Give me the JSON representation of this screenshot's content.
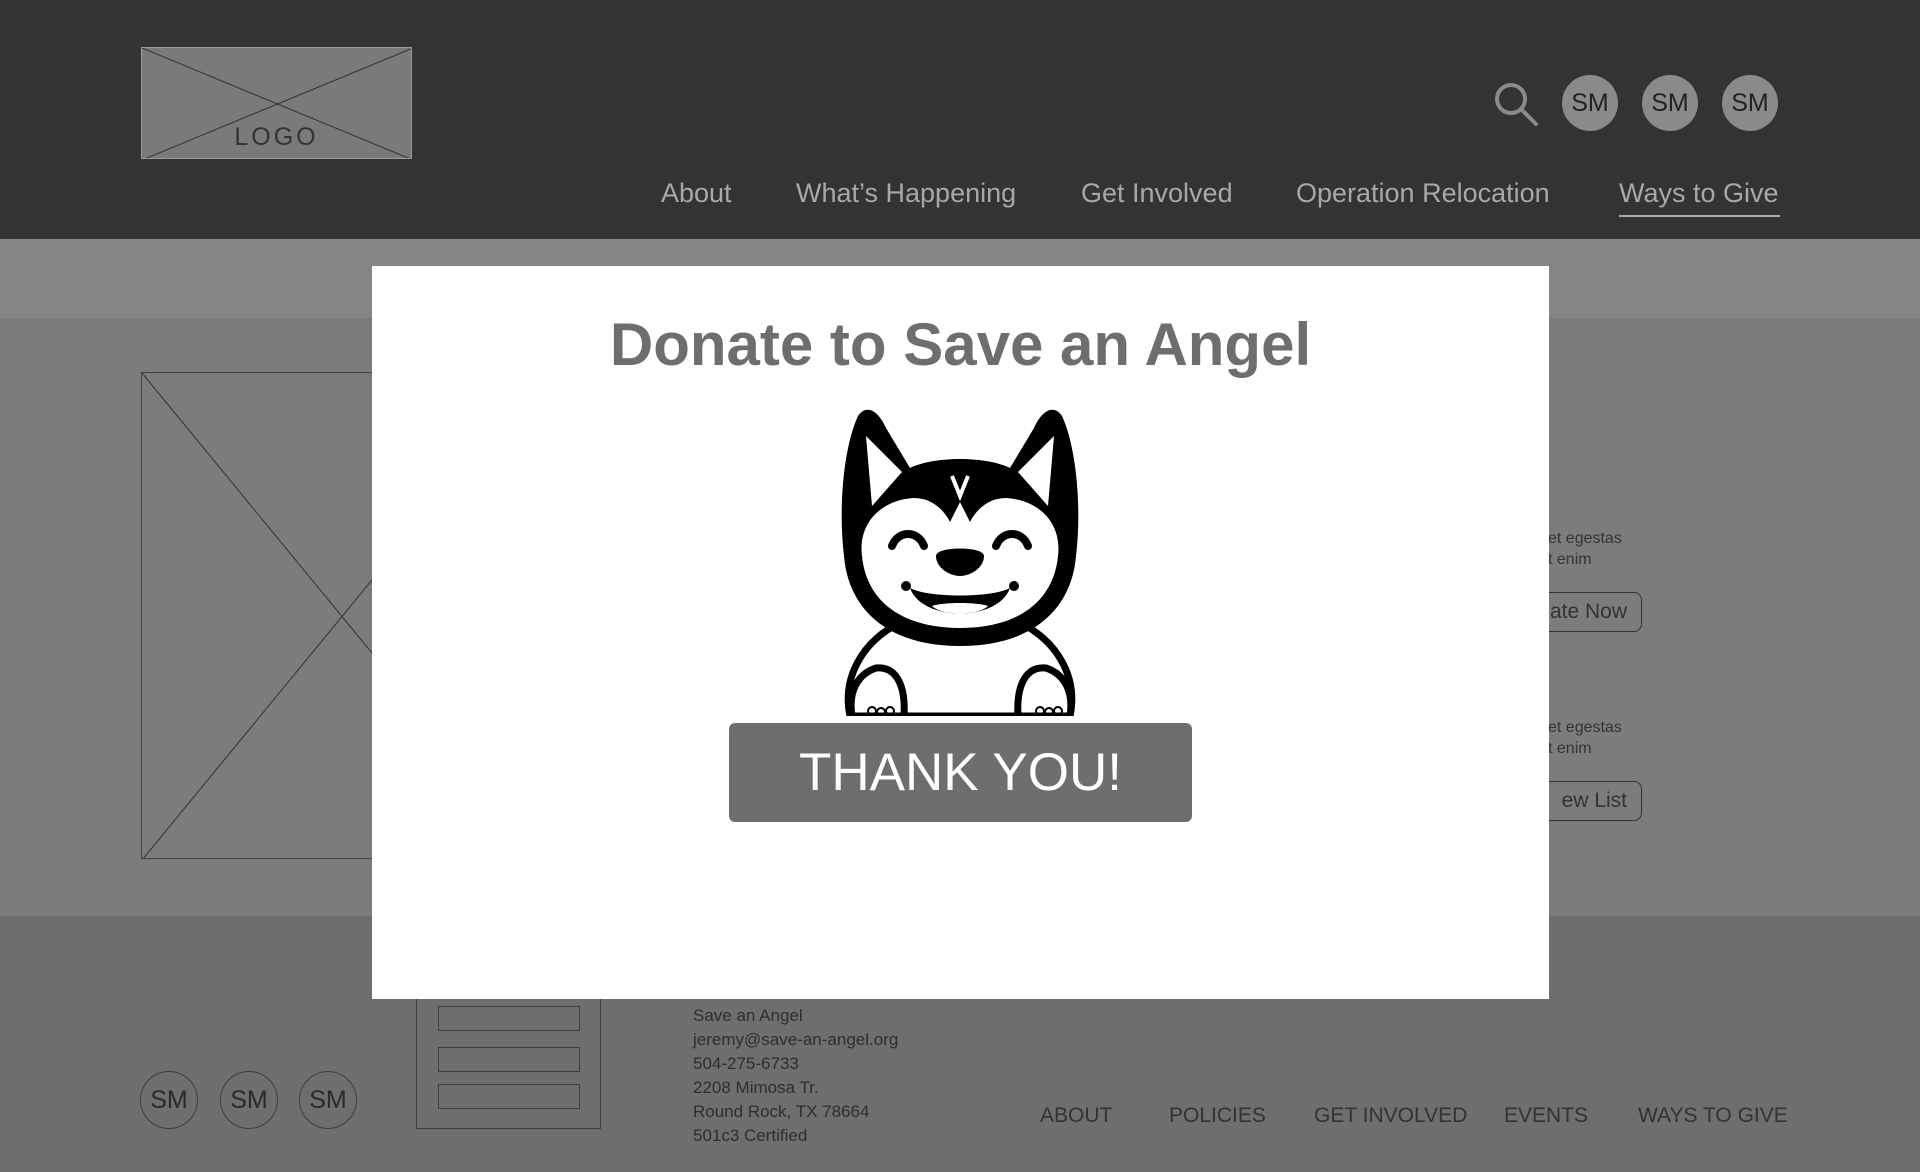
{
  "header": {
    "logo_text": "LOGO",
    "social": [
      "SM",
      "SM",
      "SM"
    ],
    "nav": [
      {
        "label": "About"
      },
      {
        "label": "What’s Happening"
      },
      {
        "label": "Get Involved"
      },
      {
        "label": "Operation Relocation"
      },
      {
        "label": "Ways to Give",
        "active": true
      }
    ]
  },
  "background": {
    "text_lines": [
      "et egestas",
      "t enim",
      "et egestas",
      "t enim"
    ],
    "buttons": [
      "ate Now",
      "ew List"
    ]
  },
  "footer": {
    "social": [
      "SM",
      "SM",
      "SM"
    ],
    "contact": [
      "Save an Angel",
      "jeremy@save-an-angel.org",
      "504-275-6733",
      "2208 Mimosa Tr.",
      "Round Rock, TX 78664",
      "501c3 Certified"
    ],
    "links": [
      "ABOUT",
      "POLICIES",
      "GET INVOLVED",
      "EVENTS",
      "WAYS TO GIVE"
    ]
  },
  "modal": {
    "title": "Donate to Save an Angel",
    "illustration": "husky-puppy-illustration",
    "button_label": "THANK YOU!"
  },
  "colors": {
    "header_bg": "#333333",
    "overlay_bg": "#6e6e6e",
    "modal_bg": "#ffffff",
    "button_bg": "#6e6e6e"
  }
}
